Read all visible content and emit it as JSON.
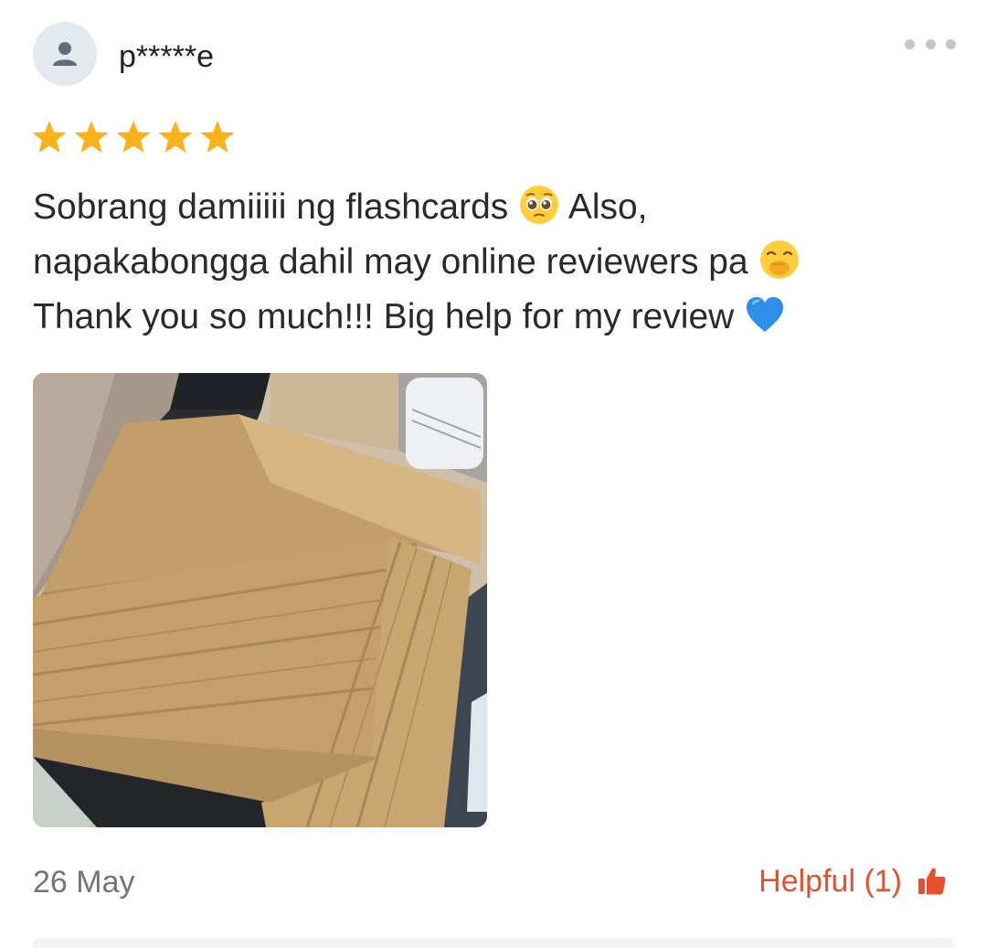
{
  "review": {
    "username": "p*****e",
    "rating": 5,
    "rating_max": 5,
    "text_lines": [
      {
        "text": "Sobrang damiiiii ng flashcards",
        "emoji": "pleading-face",
        "after": " Also,"
      },
      {
        "text": "napakabongga dahil may online reviewers pa",
        "emoji": "hand-over-mouth-face",
        "after": ""
      },
      {
        "text": "Thank you so much!!! Big help for my review",
        "emoji": "blue-heart",
        "after": ""
      }
    ],
    "photo_icon": "flashcards-box-photo",
    "date": "26 May",
    "helpful_label": "Helpful (1)",
    "helpful_icon": "thumbs-up-icon"
  },
  "colors": {
    "star": "#f9b21a",
    "helpful": "#e8502d",
    "avatar_bg": "#e4e9ee",
    "avatar_icon": "#5d6f7c",
    "menu_dots": "#c6c6c6",
    "date": "#757575"
  }
}
